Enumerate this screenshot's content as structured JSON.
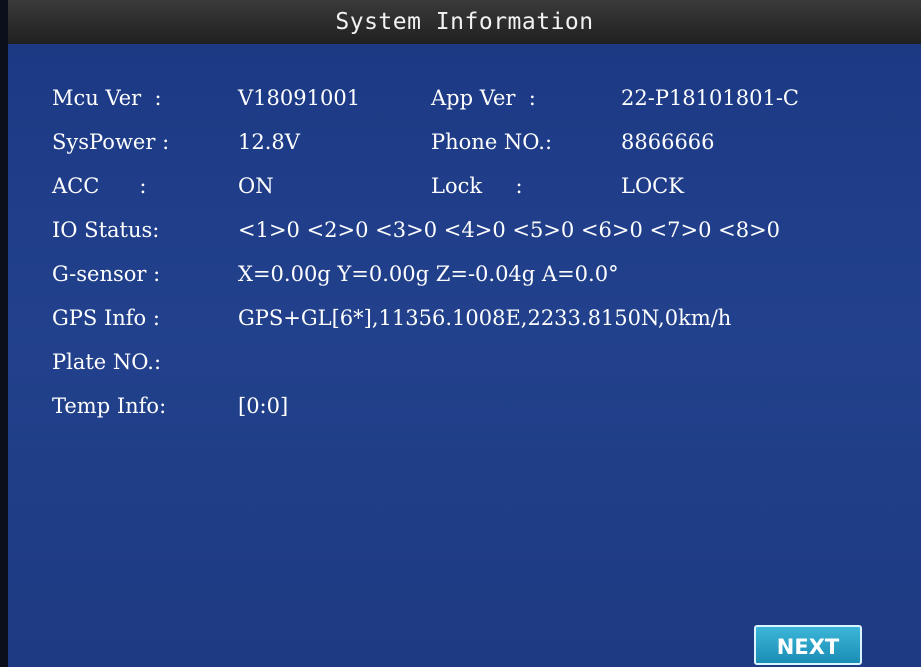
{
  "title": "System Information",
  "rows": [
    {
      "label": "Mcu Ver  :",
      "value": "V18091001",
      "label2": "App Ver  :",
      "value2": "22-P18101801-C"
    },
    {
      "label": "SysPower :",
      "value": "12.8V",
      "label2": "Phone NO.:",
      "value2": "8866666"
    },
    {
      "label": "ACC      :",
      "value": "ON",
      "label2": "Lock     :",
      "value2": "LOCK"
    },
    {
      "label": "IO Status:",
      "value": "<1>0 <2>0 <3>0 <4>0 <5>0 <6>0 <7>0 <8>0"
    },
    {
      "label": "G-sensor :",
      "value": "X=0.00g Y=0.00g Z=-0.04g A=0.0°"
    },
    {
      "label": "GPS Info :",
      "value": "GPS+GL[6*],11356.1008E,2233.8150N,0km/h"
    },
    {
      "label": "Plate NO.:",
      "value": ""
    },
    {
      "label": "Temp Info:",
      "value": "[0:0]"
    }
  ],
  "next_label": "NEXT"
}
